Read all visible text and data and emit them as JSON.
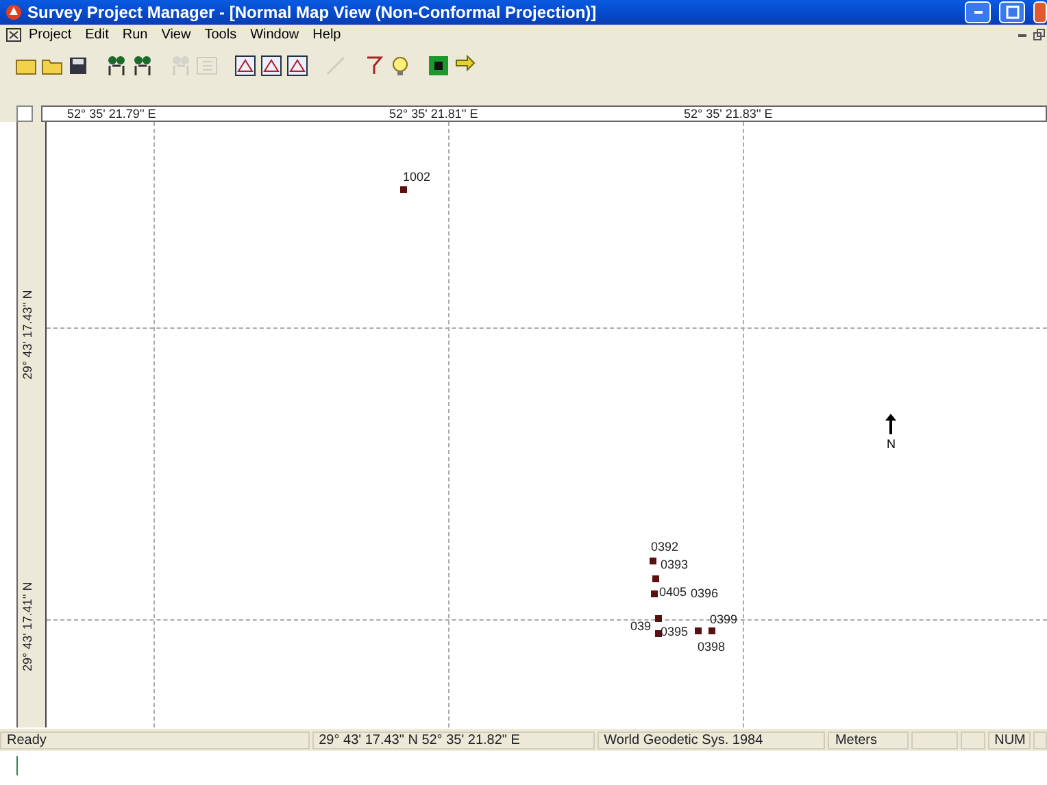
{
  "window": {
    "title": "Survey Project Manager - [Normal Map View (Non-Conformal Projection)]"
  },
  "menu": [
    "Project",
    "Edit",
    "Run",
    "View",
    "Tools",
    "Window",
    "Help"
  ],
  "toolbar": [
    {
      "kind": "new",
      "disabled": false
    },
    {
      "kind": "open",
      "disabled": false
    },
    {
      "kind": "save",
      "disabled": false
    },
    {
      "kind": "sep"
    },
    {
      "kind": "person",
      "disabled": false
    },
    {
      "kind": "person",
      "disabled": false
    },
    {
      "kind": "sep"
    },
    {
      "kind": "person",
      "disabled": true
    },
    {
      "kind": "grid",
      "disabled": true
    },
    {
      "kind": "sep"
    },
    {
      "kind": "zoom",
      "disabled": false
    },
    {
      "kind": "zoom",
      "disabled": false
    },
    {
      "kind": "zoom",
      "disabled": false
    },
    {
      "kind": "sep"
    },
    {
      "kind": "line",
      "disabled": true
    },
    {
      "kind": "sep"
    },
    {
      "kind": "help",
      "disabled": false
    },
    {
      "kind": "bulb",
      "disabled": false
    },
    {
      "kind": "sep"
    },
    {
      "kind": "square",
      "disabled": false
    },
    {
      "kind": "arrow",
      "disabled": false
    }
  ],
  "top_ruler": [
    "52° 35' 21.79'' E",
    "52° 35' 21.81'' E",
    "52° 35' 21.83'' E"
  ],
  "left_ruler": [
    "29° 43' 17.43'' N",
    "29° 43' 17.41'' N"
  ],
  "map": {
    "points": [
      {
        "label": "1002"
      },
      {
        "label": "0392"
      },
      {
        "label": "0393"
      },
      {
        "label": "0405"
      },
      {
        "label": "0396"
      },
      {
        "label": "039"
      },
      {
        "label": "0395"
      },
      {
        "label": "0399"
      },
      {
        "label": "0398"
      }
    ],
    "north_label": "N"
  },
  "status_bar": [
    "Ready",
    "29° 43' 17.43\" N  52° 35' 21.82\" E",
    "World Geodetic Sys. 1984",
    "Meters",
    "NUM"
  ]
}
